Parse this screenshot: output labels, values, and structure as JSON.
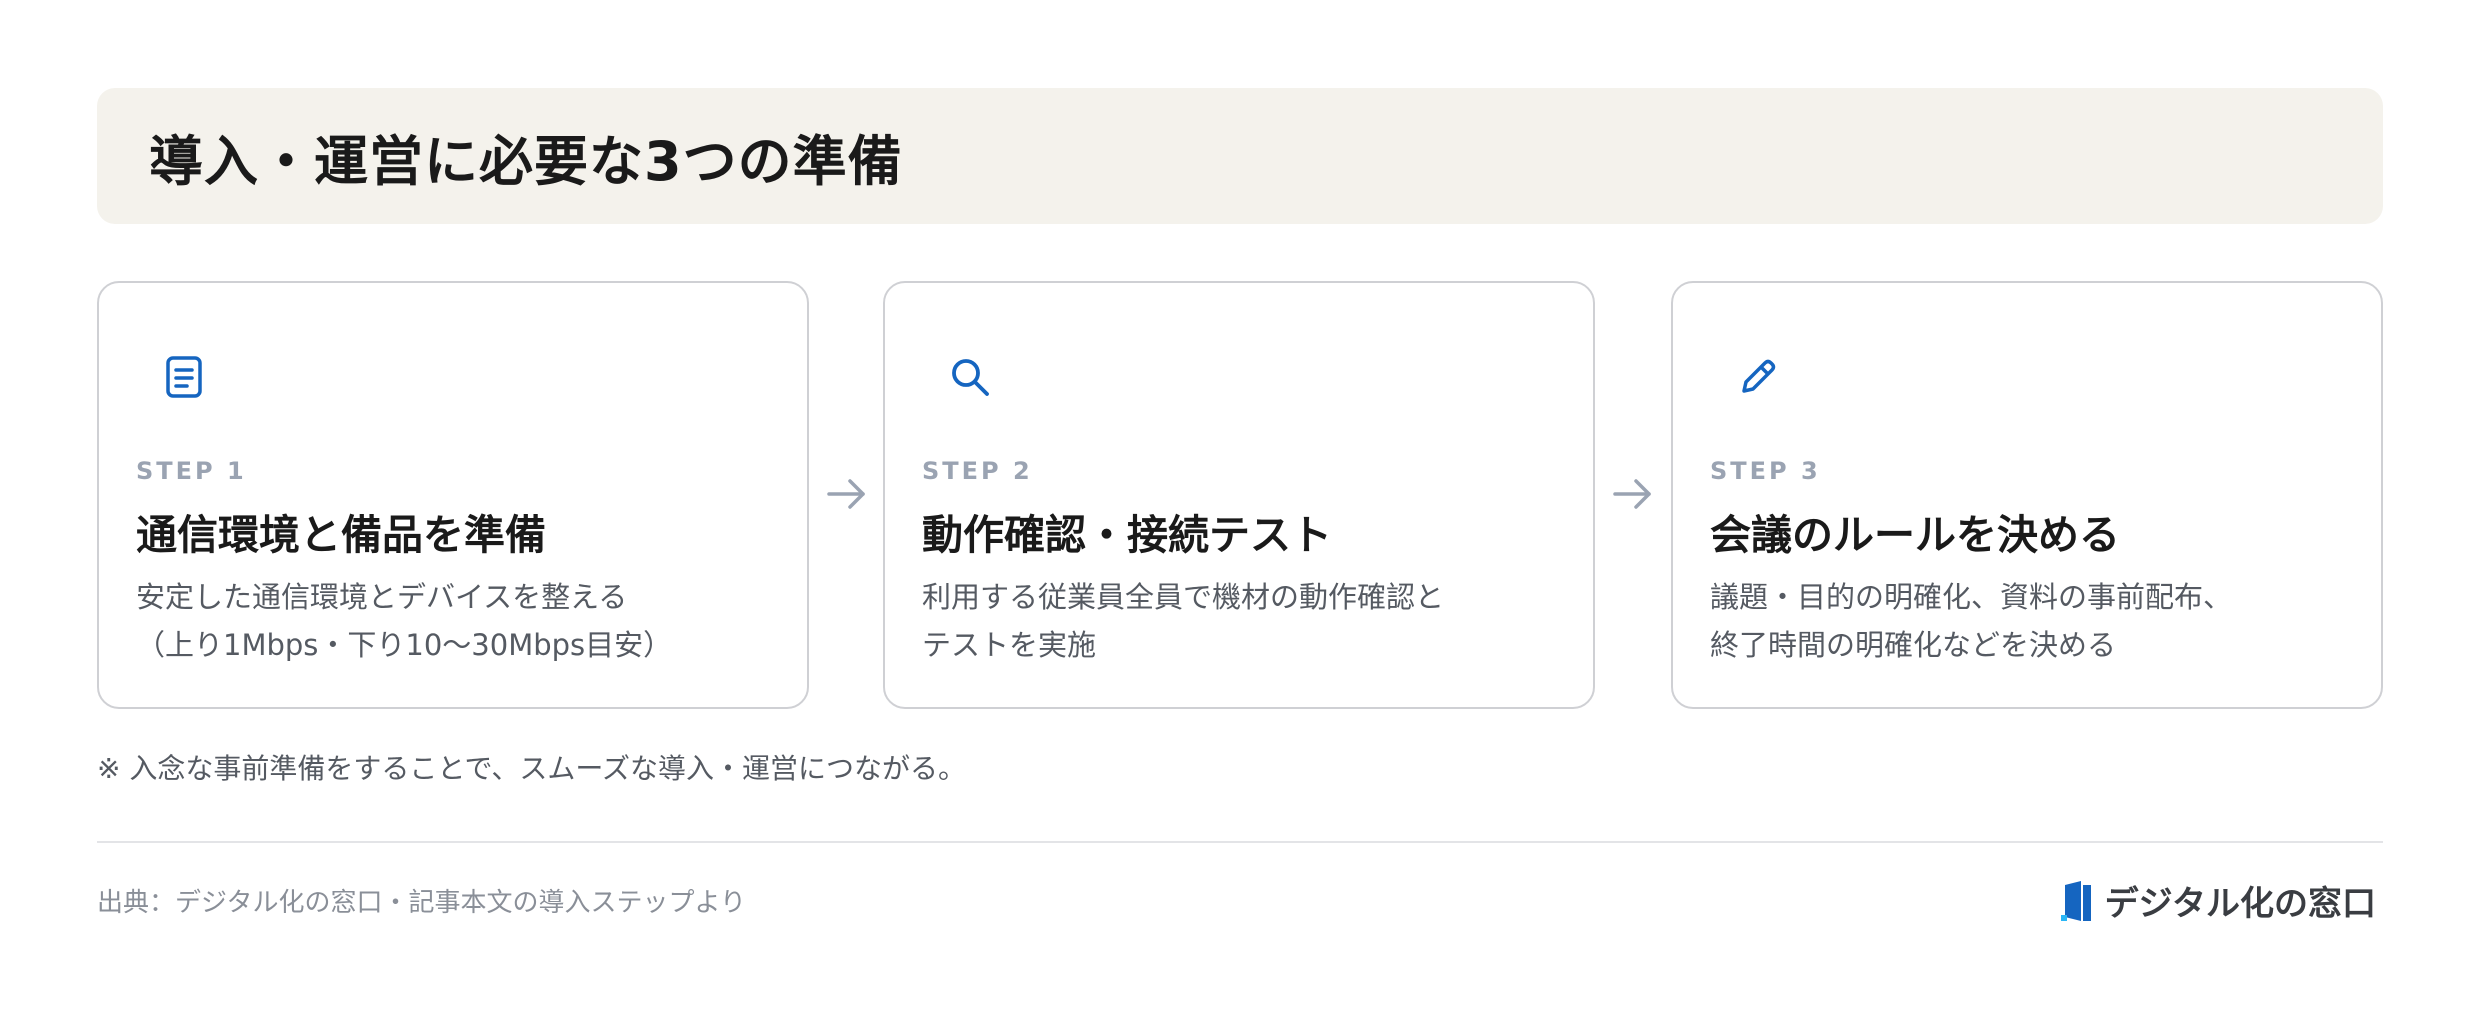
{
  "title": "導入・運営に必要な3つの準備",
  "steps": [
    {
      "icon": "document-icon",
      "step_label": "STEP 1",
      "heading": "通信環境と備品を準備",
      "desc_lines": [
        "安定した通信環境とデバイスを整える",
        "（上り1Mbps・下り10〜30Mbps目安）"
      ]
    },
    {
      "icon": "search-icon",
      "step_label": "STEP 2",
      "heading": "動作確認・接続テスト",
      "desc_lines": [
        "利用する従業員全員で機材の動作確認と",
        "テストを実施"
      ]
    },
    {
      "icon": "pencil-icon",
      "step_label": "STEP 3",
      "heading": "会議のルールを決める",
      "desc_lines": [
        "議題・目的の明確化、資料の事前配布、",
        "終了時間の明確化などを決める"
      ]
    }
  ],
  "note": "※ 入念な事前準備をすることで、スムーズな導入・運営につながる。",
  "source": "出典：デジタル化の窓口・記事本文の導入ステップより",
  "brand": {
    "name": "デジタル化の窓口",
    "logo_icon": "brand-logo-icon"
  },
  "colors": {
    "accent": "#1565c0",
    "title_bg": "#f4f2ec",
    "step_label": "#9aa3b2",
    "card_border": "#cfd0d4"
  }
}
